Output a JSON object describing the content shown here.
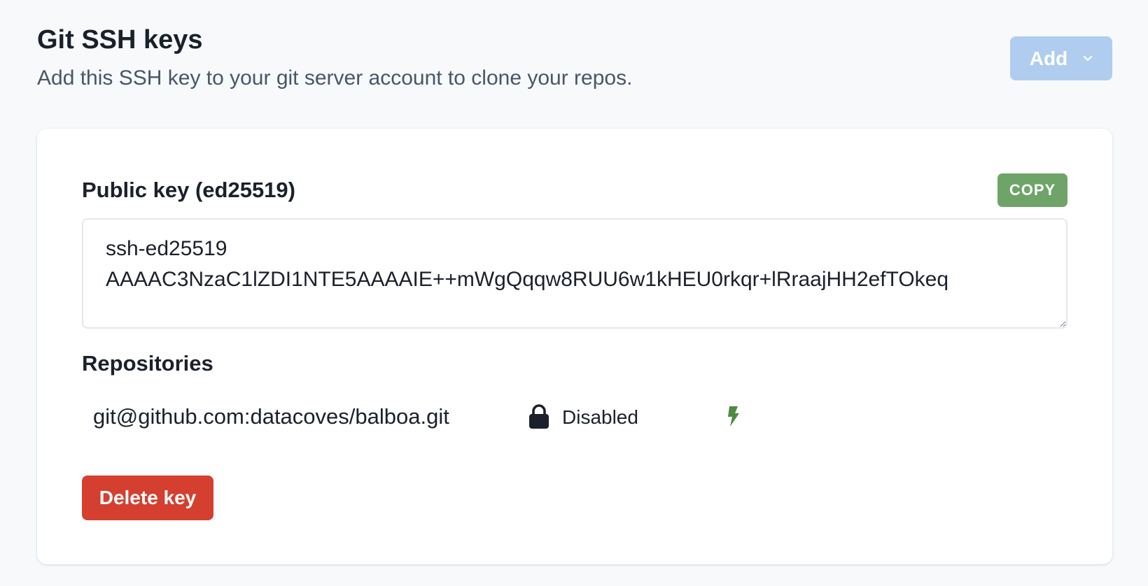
{
  "header": {
    "title": "Git SSH keys",
    "subtitle": "Add this SSH key to your git server account to clone your repos.",
    "add_label": "Add"
  },
  "card": {
    "public_key_label": "Public key (ed25519)",
    "copy_label": "COPY",
    "public_key_value": "ssh-ed25519\nAAAAC3NzaC1lZDI1NTE5AAAAIE++mWgQqqw8RUU6w1kHEU0rkqr+lRraajHH2efTOkeq",
    "repositories_heading": "Repositories",
    "repositories": [
      {
        "url": "git@github.com:datacoves/balboa.git",
        "status": "Disabled",
        "status_icon": "lock-icon",
        "action_icon": "lightning-bolt-icon"
      }
    ],
    "delete_label": "Delete key"
  },
  "colors": {
    "background": "#f7f9fb",
    "add_button_disabled": "#b0cdef",
    "copy_button": "#6fa468",
    "delete_button": "#d43f2f",
    "bolt_icon": "#4f8a45"
  }
}
